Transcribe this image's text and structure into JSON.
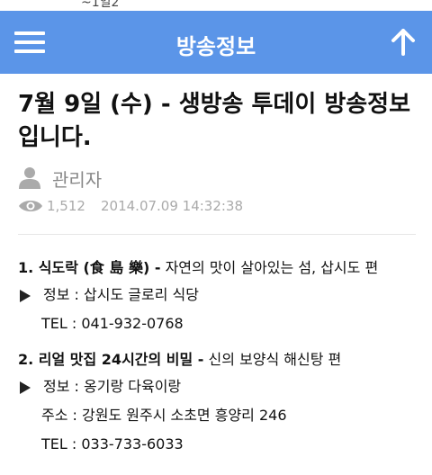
{
  "status_bar": {
    "text": "~1일2"
  },
  "app_bar": {
    "title": "방송정보"
  },
  "post": {
    "title": "7월 9일 (수) - 생방송 투데이 방송정보입니다.",
    "author": "관리자",
    "views": "1,512",
    "datetime": "2014.07.09 14:32:38"
  },
  "items": [
    {
      "headline_bold": "1. 식도락 (食 島 樂) -",
      "headline_rest": " 자연의 맛이 살아있는 섬, 삽시도 편",
      "info": "정보 : 삽시도 글로리 식당",
      "address": "",
      "tel": "TEL : 041-932-0768"
    },
    {
      "headline_bold": "2. 리얼 맛집 24시간의 비밀 -",
      "headline_rest": " 신의 보양식 해신탕 편",
      "info": "정보 : 옹기랑 다육이랑",
      "address": "주소 : 강원도 원주시 소초면 흥양리 246",
      "tel": "TEL : 033-733-6033"
    }
  ]
}
